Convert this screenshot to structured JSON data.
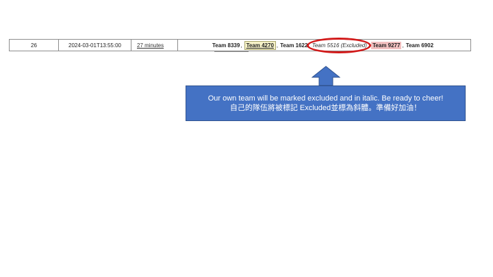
{
  "row": {
    "number": "26",
    "datetime": "2024-03-01T13:55:00",
    "duration": "27 minutes",
    "teams": [
      {
        "label": "Team 8339",
        "sep": ","
      },
      {
        "label": "Team 4270",
        "sep": ","
      },
      {
        "label": "Team 1622",
        "sep": ","
      },
      {
        "label": "Team 5516 (Excluded)",
        "sep": ","
      },
      {
        "label": "Team 9277",
        "sep": ","
      },
      {
        "label": "Team 6902",
        "sep": ""
      }
    ]
  },
  "callout": {
    "line1": "Our own team will be marked excluded and in italic. Be ready to cheer!",
    "line2": "自己的隊伍將被標記 Excluded並標為斜體。準備好加油！"
  },
  "colors": {
    "callout_bg": "#4472c4",
    "oval": "#d21a1a",
    "highlight_yellow": "#f6f2c8",
    "highlight_pink": "#f2c0c0"
  }
}
